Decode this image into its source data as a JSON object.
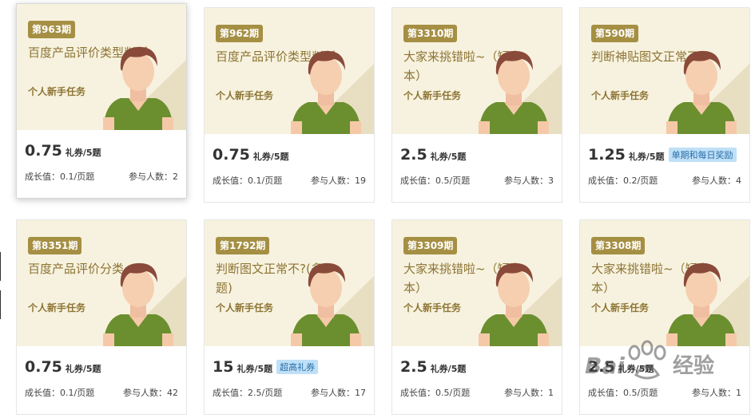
{
  "cards": [
    {
      "period": "第963期",
      "title": "百度产品评价类型判断",
      "task": "个人新手任务",
      "price": "0.75",
      "unit": "礼券/5题",
      "badge": "",
      "growth": "成长值：0.1/页题",
      "participants": "参与人数：2"
    },
    {
      "period": "第962期",
      "title": "百度产品评价类型判断",
      "task": "个人新手任务",
      "price": "0.75",
      "unit": "礼券/5题",
      "badge": "",
      "growth": "成长值：0.1/页题",
      "participants": "参与人数：19"
    },
    {
      "period": "第3310期",
      "title": "大家来挑错啦~（短文本）",
      "task": "个人新手任务",
      "price": "2.5",
      "unit": "礼券/5题",
      "badge": "",
      "growth": "成长值：0.5/页题",
      "participants": "参与人数：3"
    },
    {
      "period": "第590期",
      "title": "判断神贴图文正常不?",
      "task": "个人新手任务",
      "price": "1.25",
      "unit": "礼券/5题",
      "badge": "单期和每日奖励",
      "growth": "成长值：0.2/页题",
      "participants": "参与人数：4"
    },
    {
      "period": "第8351期",
      "title": "百度产品评价分类",
      "task": "个人新手任务",
      "price": "0.75",
      "unit": "礼券/5题",
      "badge": "",
      "growth": "成长值：0.1/页题",
      "participants": "参与人数：42"
    },
    {
      "period": "第1792期",
      "title": "判断图文正常不?(多题)",
      "task": "个人新手任务",
      "price": "15",
      "unit": "礼券/5题",
      "badge": "超高礼券",
      "growth": "成长值：2.5/页题",
      "participants": "参与人数：17"
    },
    {
      "period": "第3309期",
      "title": "大家来挑错啦~（短文本）",
      "task": "个人新手任务",
      "price": "2.5",
      "unit": "礼券/5题",
      "badge": "",
      "growth": "成长值：0.5/页题",
      "participants": "参与人数：1"
    },
    {
      "period": "第3308期",
      "title": "大家来挑错啦~（短文本）",
      "task": "个人新手任务",
      "price": "2.5",
      "unit": "礼券/5题",
      "badge": "",
      "growth": "成长值：0.5/页题",
      "participants": "参与人数：1"
    }
  ],
  "watermark": {
    "brand": "Bai",
    "text": "经验"
  },
  "colors": {
    "card_top": "#f7f2df",
    "period_badge": "#a58f43",
    "title": "#8d7434",
    "shirt": "#6b8f2f",
    "hair": "#8a4a3a",
    "badge_bg": "#bfe0f7"
  }
}
